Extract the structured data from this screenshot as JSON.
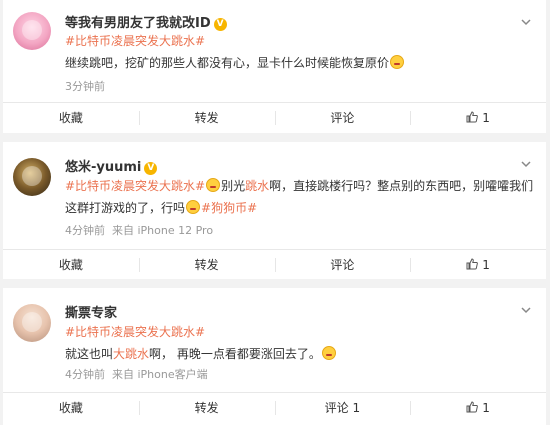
{
  "comments": [
    {
      "username": "等我有男朋友了我就改ID",
      "verified_badge": "V",
      "hashtag": "#比特币凌晨突发大跳水#",
      "text": "继续跳吧，挖矿的那些人都没有心，显卡什么时候能恢复原价",
      "time": "3分钟前",
      "source": "",
      "actions": {
        "favorite": "收藏",
        "repost": "转发",
        "comment": "评论",
        "like_count": "1"
      }
    },
    {
      "username": "悠米-yuumi",
      "verified_badge": "V",
      "hashtag": "#比特币凌晨突发大跳水#",
      "text_part1": "别光",
      "text_highlight": "跳水",
      "text_part2": "啊，直接跳楼行吗？整点别的东西吧，别嚯嚯我们这群打游戏的了，行吗",
      "hashtag2": "#狗狗币#",
      "time": "4分钟前",
      "source": "来自 iPhone 12 Pro",
      "actions": {
        "favorite": "收藏",
        "repost": "转发",
        "comment": "评论",
        "like_count": "1"
      }
    },
    {
      "username": "撕票专家",
      "hashtag": "#比特币凌晨突发大跳水#",
      "text_part1": "就这也叫",
      "text_highlight": "大跳水",
      "text_part2": "啊， 再晚一点看都要涨回去了。",
      "time": "4分钟前",
      "source": "来自 iPhone客户端",
      "actions": {
        "favorite": "收藏",
        "repost": "转发",
        "comment": "评论 1",
        "like_count": "1"
      }
    }
  ],
  "colors": {
    "hashtag": "#eb7350",
    "meta": "#999999",
    "verified": "#f7b500"
  },
  "icons": [
    "chevron-down-icon",
    "thumbs-up-icon",
    "emoji-icon",
    "verified-icon"
  ]
}
